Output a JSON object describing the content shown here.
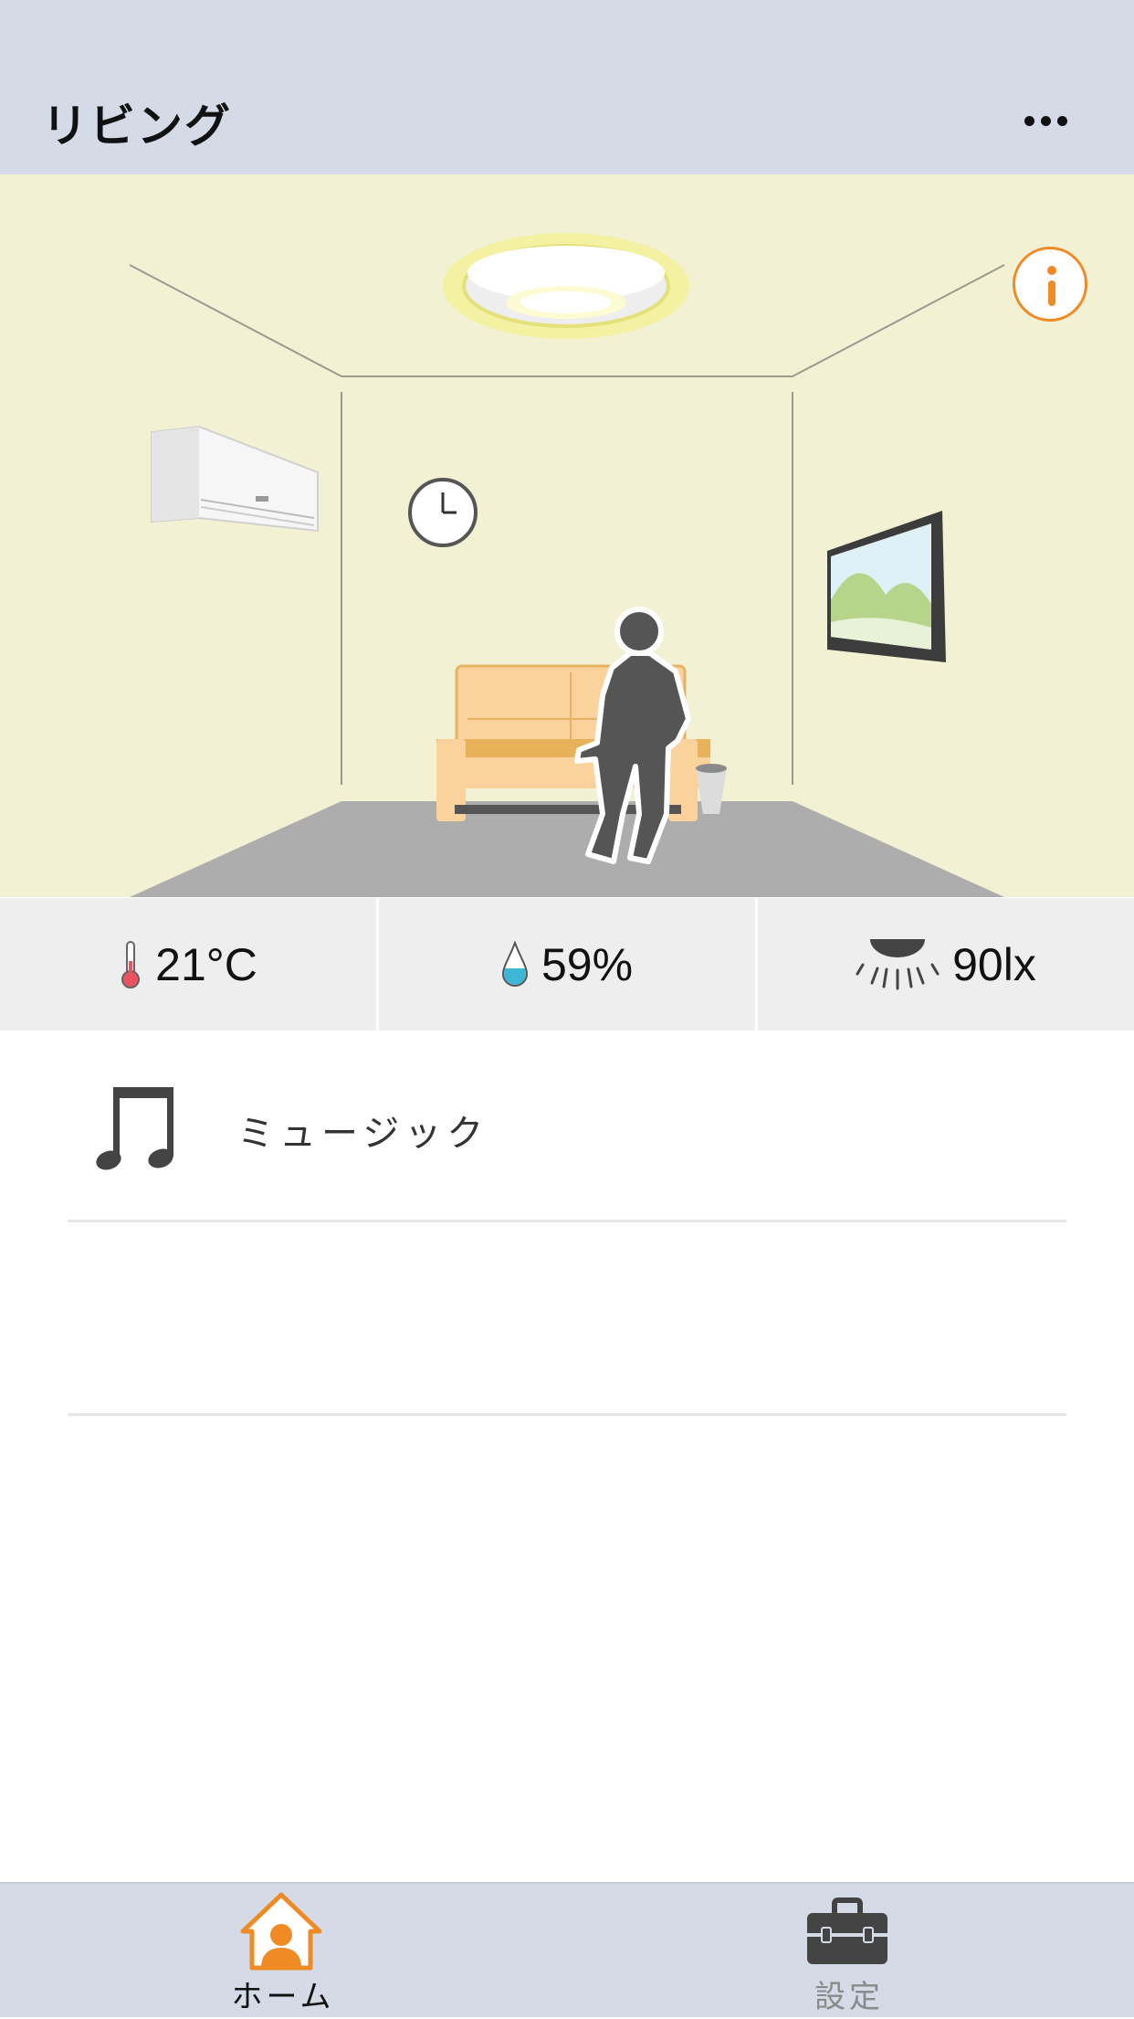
{
  "header": {
    "title": "リビング"
  },
  "room": {
    "description_icons": [
      "ceiling-light-icon",
      "air-conditioner-icon",
      "wall-clock-icon",
      "sofa-icon",
      "person-icon",
      "picture-frame-icon",
      "info-icon"
    ]
  },
  "sensors": {
    "temperature": {
      "value": "21°C",
      "icon": "thermometer-icon"
    },
    "humidity": {
      "value": "59%",
      "icon": "water-drop-icon"
    },
    "illuminance": {
      "value": "90lx",
      "icon": "light-icon"
    }
  },
  "list": {
    "items": [
      {
        "label": "ミュージック",
        "icon": "music-note-icon"
      }
    ]
  },
  "tabbar": {
    "home_label": "ホーム",
    "settings_label": "設定"
  },
  "colors": {
    "accent": "#f08a24",
    "header_bg": "#d4dbe6",
    "room_bg": "#f3f1d3",
    "sensor_bg": "#eeeeee"
  }
}
